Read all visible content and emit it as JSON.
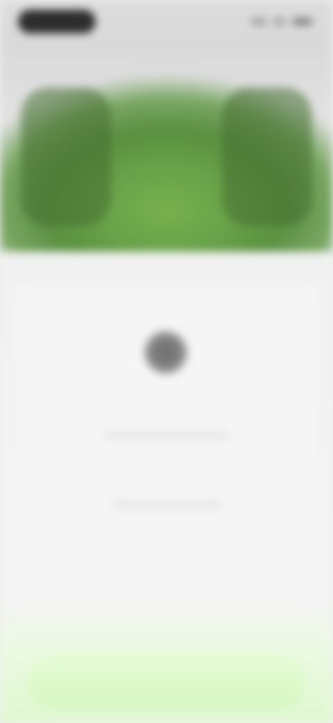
{
  "status_bar": {
    "time_label": "",
    "icons": [
      "signal-icon",
      "wifi-icon",
      "battery-icon"
    ]
  },
  "hero": {
    "accent": "#6aa44a",
    "accent_dark": "#568c3d"
  },
  "content": {
    "loading_state": "loading",
    "background": "#f4f4f4"
  },
  "bottom_action": {
    "label": "",
    "color": "#d7f7c0"
  }
}
